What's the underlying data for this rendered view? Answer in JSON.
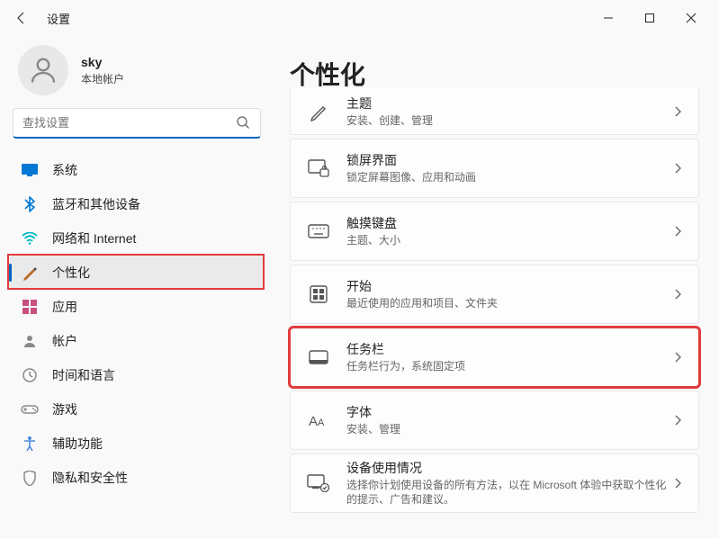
{
  "window": {
    "title": "设置"
  },
  "account": {
    "name": "sky",
    "type": "本地帐户"
  },
  "search": {
    "placeholder": "查找设置"
  },
  "nav": [
    {
      "icon": "system",
      "label": "系统",
      "color": "#0078d4"
    },
    {
      "icon": "bluetooth",
      "label": "蓝牙和其他设备",
      "color": "#0078d4"
    },
    {
      "icon": "network",
      "label": "网络和 Internet",
      "color": "#00b7c3"
    },
    {
      "icon": "personalize",
      "label": "个性化",
      "active": true,
      "color": "#b96b2a"
    },
    {
      "icon": "apps",
      "label": "应用",
      "color": "#c94f7f"
    },
    {
      "icon": "accounts",
      "label": "帐户",
      "color": "#8a8a8a"
    },
    {
      "icon": "time",
      "label": "时间和语言",
      "color": "#8a8a8a"
    },
    {
      "icon": "gaming",
      "label": "游戏",
      "color": "#8a8a8a"
    },
    {
      "icon": "accessibility",
      "label": "辅助功能",
      "color": "#4a89dc"
    },
    {
      "icon": "privacy",
      "label": "隐私和安全性",
      "color": "#8a8a8a"
    }
  ],
  "page": {
    "title": "个性化"
  },
  "cards": [
    {
      "icon": "theme",
      "title": "主题",
      "desc": "安装、创建、管理",
      "short": true
    },
    {
      "icon": "lock",
      "title": "锁屏界面",
      "desc": "锁定屏幕图像、应用和动画"
    },
    {
      "icon": "keyboard",
      "title": "触摸键盘",
      "desc": "主题、大小"
    },
    {
      "icon": "start",
      "title": "开始",
      "desc": "最近使用的应用和项目、文件夹"
    },
    {
      "icon": "taskbar",
      "title": "任务栏",
      "desc": "任务栏行为，系统固定项",
      "highlighted": true
    },
    {
      "icon": "font",
      "title": "字体",
      "desc": "安装、管理"
    },
    {
      "icon": "usage",
      "title": "设备使用情况",
      "desc": "选择你计划使用设备的所有方法，以在 Microsoft 体验中获取个性化的提示、广告和建议。"
    }
  ],
  "colors": {
    "highlight": "#e23c3c",
    "accent": "#0067c0"
  }
}
